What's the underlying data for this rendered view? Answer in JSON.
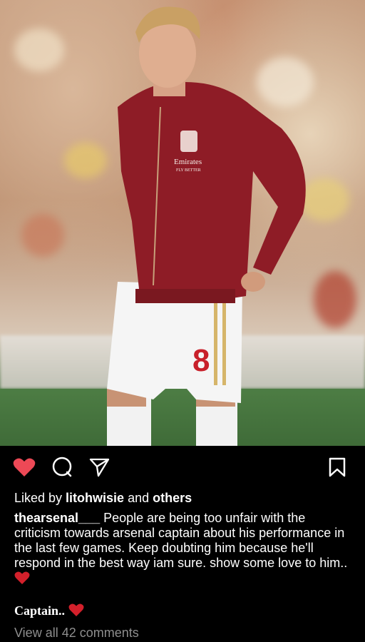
{
  "post": {
    "image_description": "Photo of a footballer in a red track jacket and white shorts",
    "shirt_number": "8",
    "jacket_brand": "Emirates",
    "jacket_slogan": "FLY BETTER"
  },
  "actions": {
    "like_icon": "heart-icon",
    "comment_icon": "comment-icon",
    "share_icon": "send-icon",
    "save_icon": "bookmark-icon",
    "like_color": "#ed4956"
  },
  "likes": {
    "prefix": "Liked by ",
    "user": "litohwisie",
    "middle": " and ",
    "others": "others"
  },
  "caption": {
    "username": "thearsenal___",
    "text": " People are being too unfair with the criticism towards arsenal captain about his performance in the last few games. Keep doubting him because he'll respond in the best way iam sure. show some love to him.. "
  },
  "comment": {
    "text": "Captain.. "
  },
  "view_comments": "View all 42 comments"
}
